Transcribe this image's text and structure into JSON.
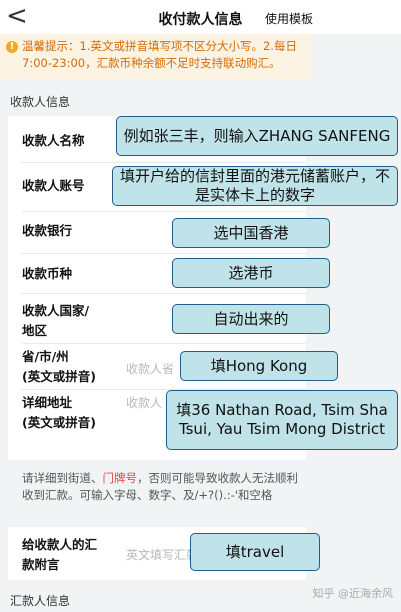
{
  "header": {
    "back": "<",
    "title": "收付款人信息",
    "template_label": "使用模板"
  },
  "notice": {
    "icon": "!",
    "text": "温馨提示：1.英文或拼音填写项不区分大小写。2.每日7:00-23:00，汇款币种余额不足时支持联动购汇。"
  },
  "sections": {
    "payee": "收款人信息",
    "payer": "汇款人信息"
  },
  "rows": {
    "name": "收款人名称",
    "account": "收款人账号",
    "bank": "收款银行",
    "currency": "收款币种",
    "country_1": "收款人国家/",
    "country_2": "地区",
    "province_1": "省/市/州",
    "province_2": "(英文或拼音)",
    "province_placeholder": "收款人省",
    "address_1": "详细地址",
    "address_2": "(英文或拼音)",
    "address_placeholder": "收款人",
    "memo_1": "给收款人的汇",
    "memo_2": "款附言",
    "memo_placeholder": "英文填写汇款"
  },
  "hint": {
    "part1": "请详细到街道、",
    "red": "门牌号",
    "part2": "，否则可能导致收款人无法顺利收到汇款。可输入字母、数字、及/+?().:-'和空格"
  },
  "callouts": {
    "name": "例如张三丰，则输入ZHANG SANFENG",
    "account": "填开户给的信封里面的港元储蓄账户，不是实体卡上的数字",
    "bank": "选中国香港",
    "currency": "选港币",
    "country": "自动出来的",
    "province": "填Hong Kong",
    "address": "填36 Nathan Road, Tsim Sha Tsui, Yau Tsim Mong District",
    "memo": "填travel"
  },
  "watermark": "知乎 @近海余风"
}
